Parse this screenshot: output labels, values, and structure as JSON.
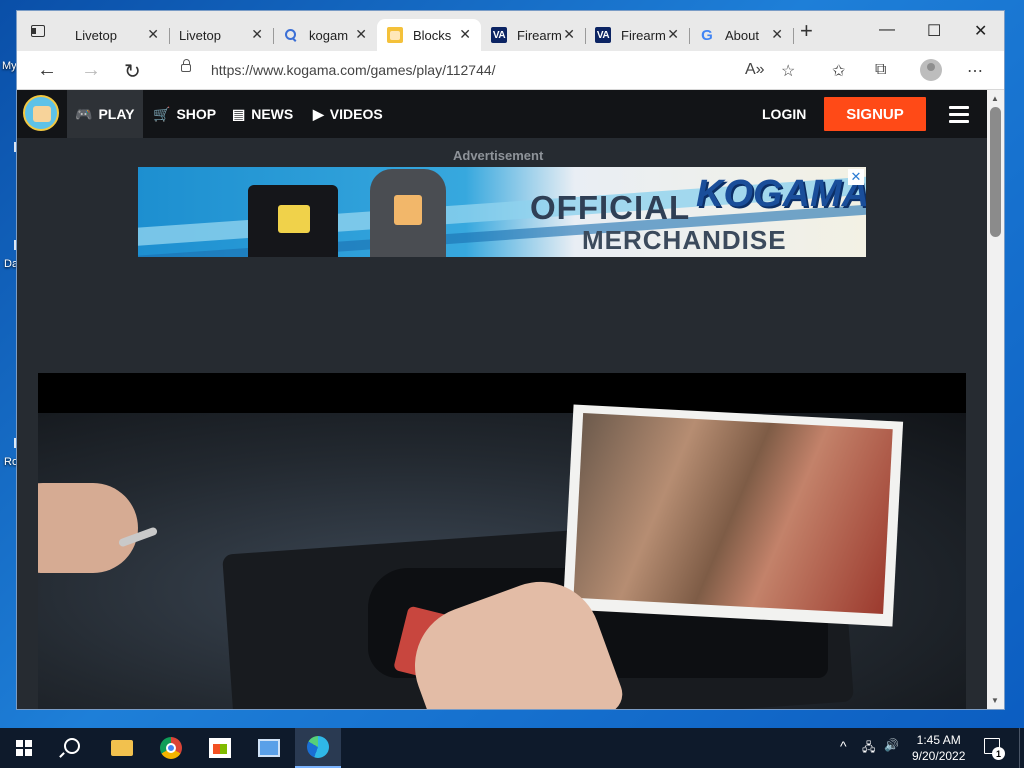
{
  "desktop": {
    "labels": [
      "My",
      "Da",
      "Ro"
    ]
  },
  "browser": {
    "tabs": [
      {
        "title": "Livetop",
        "favicon": "page-icon"
      },
      {
        "title": "Livetop",
        "favicon": "page-icon"
      },
      {
        "title": "kogam",
        "favicon": "search-icon"
      },
      {
        "title": "Blocks",
        "favicon": "kogama-icon",
        "active": true
      },
      {
        "title": "Firearm",
        "favicon": "va-icon"
      },
      {
        "title": "Firearm",
        "favicon": "va-icon"
      },
      {
        "title": "About",
        "favicon": "google-icon"
      }
    ],
    "favicon_text": {
      "va": "VA",
      "google": "G"
    },
    "new_tab": "+",
    "caption": {
      "minimize": "—",
      "maximize": "☐",
      "close": "✕"
    },
    "address": {
      "url": "https://www.kogama.com/games/play/112744/"
    },
    "nav": {
      "back": "←",
      "forward": "→",
      "refresh": "↻"
    },
    "toolbar_icons": {
      "read_aloud": "A»",
      "add_favorite": "☆",
      "favorites": "✩",
      "collections": "⧉",
      "more": "⋯"
    }
  },
  "site": {
    "nav": {
      "play": "PLAY",
      "shop": "SHOP",
      "news": "NEWS",
      "videos": "VIDEOS",
      "login": "LOGIN",
      "signup": "SIGNUP"
    },
    "nav_icons": {
      "play": "🎮",
      "shop": "🛒",
      "news": "▤",
      "videos": "▶"
    },
    "ad": {
      "label": "Advertisement",
      "line1": "OFFICIAL",
      "brand": "KOGAMA",
      "line2": "MERCHANDISE",
      "close": "✕"
    }
  },
  "taskbar": {
    "time": "1:45 AM",
    "date": "9/20/2022",
    "notifications": "1",
    "tray": {
      "chevron": "^",
      "network": "🖧",
      "volume": "🔊"
    }
  }
}
